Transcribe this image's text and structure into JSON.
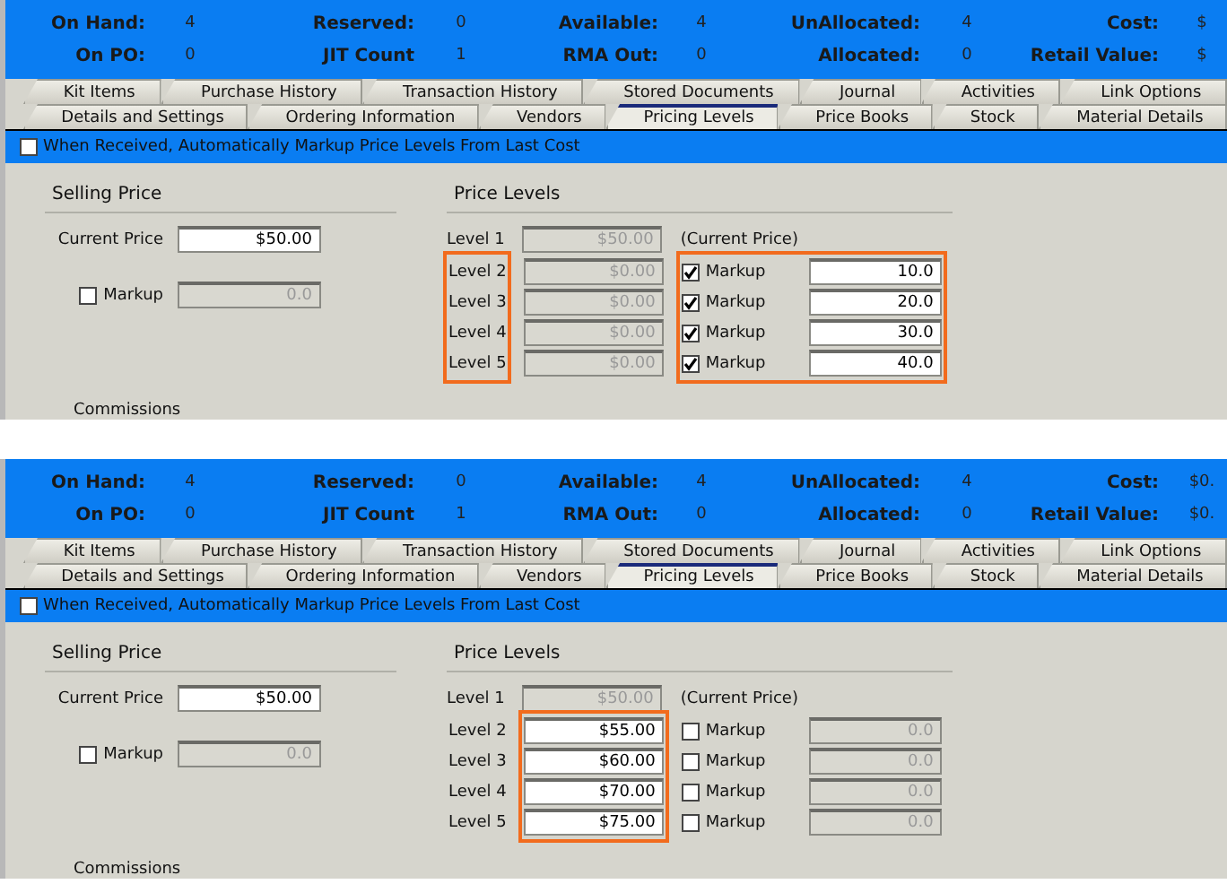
{
  "panels": [
    {
      "stats": [
        {
          "label": "On Hand:",
          "value": "4"
        },
        {
          "label": "Reserved:",
          "value": "0"
        },
        {
          "label": "Available:",
          "value": "4"
        },
        {
          "label": "UnAllocated:",
          "value": "4"
        },
        {
          "label": "Cost:",
          "value": "$"
        },
        {
          "label": "On PO:",
          "value": "0"
        },
        {
          "label": "JIT Count",
          "value": "1"
        },
        {
          "label": "RMA Out:",
          "value": "0"
        },
        {
          "label": "Allocated:",
          "value": "0"
        },
        {
          "label": "Retail Value:",
          "value": "$"
        }
      ],
      "tab_rows": [
        [
          {
            "label": "Kit Items",
            "selected": false
          },
          {
            "label": "Purchase History",
            "selected": false
          },
          {
            "label": "Transaction History",
            "selected": false
          },
          {
            "label": "Stored Documents",
            "selected": false
          },
          {
            "label": "Journal",
            "selected": false
          },
          {
            "label": "Activities",
            "selected": false
          },
          {
            "label": "Link Options",
            "selected": false
          }
        ],
        [
          {
            "label": "Details and Settings",
            "selected": false
          },
          {
            "label": "Ordering Information",
            "selected": false
          },
          {
            "label": "Vendors",
            "selected": false
          },
          {
            "label": "Pricing Levels",
            "selected": true
          },
          {
            "label": "Price Books",
            "selected": false
          },
          {
            "label": "Stock",
            "selected": false
          },
          {
            "label": "Material Details",
            "selected": false
          }
        ]
      ],
      "auto_markup": {
        "label": "When Received,  Automatically Markup Price Levels From Last Cost",
        "checked": false
      },
      "selling_price": {
        "title": "Selling Price",
        "current_label": "Current Price",
        "current_value": "$50.00",
        "markup_label": "Markup",
        "markup_checked": false,
        "markup_value": "0.0"
      },
      "price_levels": {
        "title": "Price Levels",
        "current_price_note": "(Current Price)",
        "highlight_labels": true,
        "highlight_prices": false,
        "highlight_markups": true,
        "levels": [
          {
            "label": "Level 1",
            "price": "$50.00",
            "price_enabled": false
          },
          {
            "label": "Level 2",
            "price": "$0.00",
            "price_enabled": false,
            "markup_label": "Markup",
            "markup_checked": true,
            "markup_value": "10.0"
          },
          {
            "label": "Level 3",
            "price": "$0.00",
            "price_enabled": false,
            "markup_label": "Markup",
            "markup_checked": true,
            "markup_value": "20.0"
          },
          {
            "label": "Level 4",
            "price": "$0.00",
            "price_enabled": false,
            "markup_label": "Markup",
            "markup_checked": true,
            "markup_value": "30.0"
          },
          {
            "label": "Level 5",
            "price": "$0.00",
            "price_enabled": false,
            "markup_label": "Markup",
            "markup_checked": true,
            "markup_value": "40.0"
          }
        ]
      },
      "commissions": "Commissions"
    },
    {
      "stats": [
        {
          "label": "On Hand:",
          "value": "4"
        },
        {
          "label": "Reserved:",
          "value": "0"
        },
        {
          "label": "Available:",
          "value": "4"
        },
        {
          "label": "UnAllocated:",
          "value": "4"
        },
        {
          "label": "Cost:",
          "value": "$0."
        },
        {
          "label": "On PO:",
          "value": "0"
        },
        {
          "label": "JIT Count",
          "value": "1"
        },
        {
          "label": "RMA Out:",
          "value": "0"
        },
        {
          "label": "Allocated:",
          "value": "0"
        },
        {
          "label": "Retail Value:",
          "value": "$0."
        }
      ],
      "tab_rows": [
        [
          {
            "label": "Kit Items",
            "selected": false
          },
          {
            "label": "Purchase History",
            "selected": false
          },
          {
            "label": "Transaction History",
            "selected": false
          },
          {
            "label": "Stored Documents",
            "selected": false
          },
          {
            "label": "Journal",
            "selected": false
          },
          {
            "label": "Activities",
            "selected": false
          },
          {
            "label": "Link Options",
            "selected": false
          }
        ],
        [
          {
            "label": "Details and Settings",
            "selected": false
          },
          {
            "label": "Ordering Information",
            "selected": false
          },
          {
            "label": "Vendors",
            "selected": false
          },
          {
            "label": "Pricing Levels",
            "selected": true
          },
          {
            "label": "Price Books",
            "selected": false
          },
          {
            "label": "Stock",
            "selected": false
          },
          {
            "label": "Material Details",
            "selected": false
          }
        ]
      ],
      "auto_markup": {
        "label": "When Received,  Automatically Markup Price Levels From Last Cost",
        "checked": false
      },
      "selling_price": {
        "title": "Selling Price",
        "current_label": "Current Price",
        "current_value": "$50.00",
        "markup_label": "Markup",
        "markup_checked": false,
        "markup_value": "0.0"
      },
      "price_levels": {
        "title": "Price Levels",
        "current_price_note": "(Current Price)",
        "highlight_labels": false,
        "highlight_prices": true,
        "highlight_markups": false,
        "levels": [
          {
            "label": "Level 1",
            "price": "$50.00",
            "price_enabled": false
          },
          {
            "label": "Level 2",
            "price": "$55.00",
            "price_enabled": true,
            "markup_label": "Markup",
            "markup_checked": false,
            "markup_value": "0.0"
          },
          {
            "label": "Level 3",
            "price": "$60.00",
            "price_enabled": true,
            "markup_label": "Markup",
            "markup_checked": false,
            "markup_value": "0.0"
          },
          {
            "label": "Level 4",
            "price": "$70.00",
            "price_enabled": true,
            "markup_label": "Markup",
            "markup_checked": false,
            "markup_value": "0.0"
          },
          {
            "label": "Level 5",
            "price": "$75.00",
            "price_enabled": true,
            "markup_label": "Markup",
            "markup_checked": false,
            "markup_value": "0.0"
          }
        ]
      },
      "commissions": "Commissions"
    }
  ]
}
